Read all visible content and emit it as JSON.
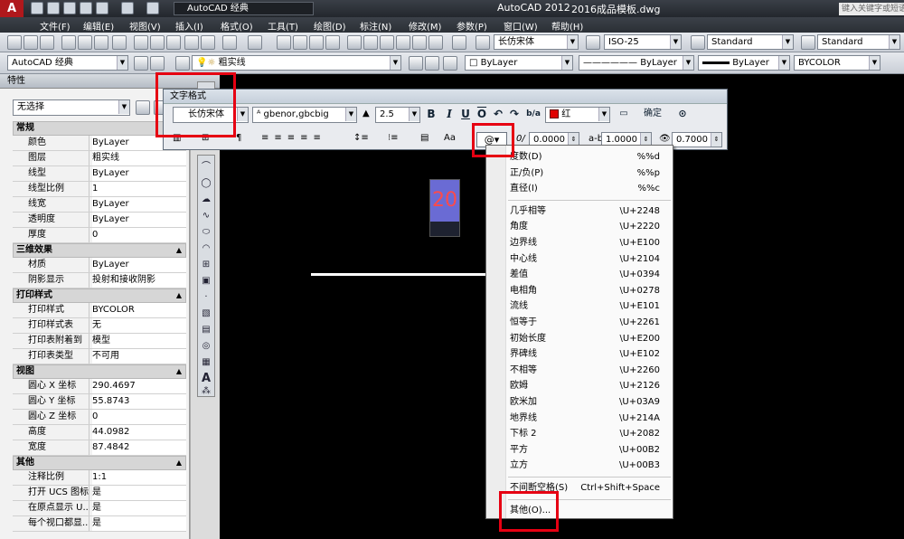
{
  "window": {
    "app_logo": "A",
    "workspace": "AutoCAD 经典",
    "title": "AutoCAD 2012",
    "document": "2016成品模板.dwg",
    "search_placeholder": "键入关键字或短语"
  },
  "menu": [
    "文件(F)",
    "编辑(E)",
    "视图(V)",
    "插入(I)",
    "格式(O)",
    "工具(T)",
    "绘图(D)",
    "标注(N)",
    "修改(M)",
    "参数(P)",
    "窗口(W)",
    "帮助(H)"
  ],
  "toolbar_styles": {
    "text_style": "长仿宋体",
    "dim_style": "ISO-25",
    "table_style": "Standard",
    "mleader_style": "Standard"
  },
  "toolbar_layers": {
    "workspace": "AutoCAD 经典",
    "layer": "粗实线",
    "color": "ByLayer",
    "linetype": "ByLayer",
    "lineweight": "ByLayer",
    "plotstyle": "BYCOLOR"
  },
  "properties": {
    "title": "特性",
    "selection": "无选择",
    "sections": [
      {
        "title": "常规",
        "rows": [
          [
            "颜色",
            "ByLayer"
          ],
          [
            "图层",
            "粗实线"
          ],
          [
            "线型",
            "ByLayer"
          ],
          [
            "线型比例",
            "1"
          ],
          [
            "线宽",
            "ByLayer"
          ],
          [
            "透明度",
            "ByLayer"
          ],
          [
            "厚度",
            "0"
          ]
        ]
      },
      {
        "title": "三维效果",
        "rows": [
          [
            "材质",
            "ByLayer"
          ],
          [
            "阴影显示",
            "投射和接收阴影"
          ]
        ]
      },
      {
        "title": "打印样式",
        "rows": [
          [
            "打印样式",
            "BYCOLOR"
          ],
          [
            "打印样式表",
            "无"
          ],
          [
            "打印表附着到",
            "模型"
          ],
          [
            "打印表类型",
            "不可用"
          ]
        ]
      },
      {
        "title": "视图",
        "rows": [
          [
            "圆心 X 坐标",
            "290.4697"
          ],
          [
            "圆心 Y 坐标",
            "55.8743"
          ],
          [
            "圆心 Z 坐标",
            "0"
          ],
          [
            "高度",
            "44.0982"
          ],
          [
            "宽度",
            "87.4842"
          ]
        ]
      },
      {
        "title": "其他",
        "rows": [
          [
            "注释比例",
            "1:1"
          ],
          [
            "打开 UCS 图标",
            "是"
          ],
          [
            "在原点显示 U...",
            "是"
          ],
          [
            "每个视口都显...",
            "是"
          ]
        ]
      }
    ]
  },
  "text_format": {
    "title": "文字格式",
    "style": "长仿宋体",
    "font": "gbenor,gbcbig",
    "height": "2.5",
    "bold": "B",
    "italic": "I",
    "underline": "U",
    "overline": "O",
    "color": "红",
    "ok": "确定",
    "symbol_button": "@▾",
    "oblique": "0.0000",
    "tracking": "1.0000",
    "width_factor": "0.7000"
  },
  "canvas": {
    "mtext_value": "20"
  },
  "symbol_menu": {
    "items": [
      [
        "度数(D)",
        "%%d"
      ],
      [
        "正/负(P)",
        "%%p"
      ],
      [
        "直径(I)",
        "%%c"
      ],
      [
        "几乎相等",
        "\\U+2248"
      ],
      [
        "角度",
        "\\U+2220"
      ],
      [
        "边界线",
        "\\U+E100"
      ],
      [
        "中心线",
        "\\U+2104"
      ],
      [
        "差值",
        "\\U+0394"
      ],
      [
        "电相角",
        "\\U+0278"
      ],
      [
        "流线",
        "\\U+E101"
      ],
      [
        "恒等于",
        "\\U+2261"
      ],
      [
        "初始长度",
        "\\U+E200"
      ],
      [
        "界碑线",
        "\\U+E102"
      ],
      [
        "不相等",
        "\\U+2260"
      ],
      [
        "欧姆",
        "\\U+2126"
      ],
      [
        "欧米加",
        "\\U+03A9"
      ],
      [
        "地界线",
        "\\U+214A"
      ],
      [
        "下标 2",
        "\\U+2082"
      ],
      [
        "平方",
        "\\U+00B2"
      ],
      [
        "立方",
        "\\U+00B3"
      ],
      [
        "不间断空格(S)",
        "Ctrl+Shift+Space"
      ],
      [
        "其他(O)...",
        ""
      ]
    ]
  }
}
